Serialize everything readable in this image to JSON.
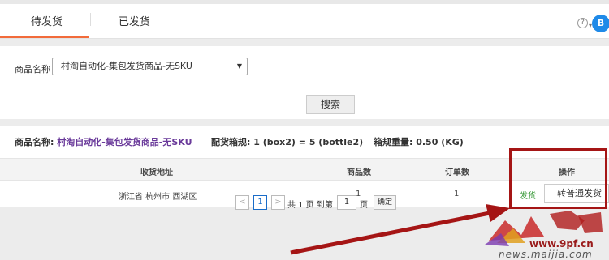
{
  "tabs": [
    {
      "label": "待发货",
      "active": true
    },
    {
      "label": "已发货",
      "active": false
    }
  ],
  "header": {
    "help_icon": "?",
    "avatar_initial": "B"
  },
  "filter": {
    "product_label": "商品名称",
    "product_selected": "村淘自动化-集包发货商品-无SKU",
    "search_button": "搜索"
  },
  "summary": {
    "product_prefix": "商品名称: ",
    "product_name": "村淘自动化-集包发货商品-无SKU",
    "package_spec": "配货箱规: 1 (box2) = 5 (bottle2)",
    "package_weight": "箱规重量: 0.50 (KG)"
  },
  "table": {
    "headers": [
      "收货地址",
      "商品数",
      "订单数",
      "操作"
    ],
    "rows": [
      {
        "address": "浙江省 杭州市 西湖区",
        "item_count": "1",
        "order_count": "1",
        "ship_action": "发货",
        "convert_action": "转普通发货"
      }
    ]
  },
  "pagination": {
    "prev": "<",
    "current": "1",
    "next": ">",
    "total_text": "共 1 页 到第",
    "goto_value": "1",
    "page_unit": "页",
    "confirm": "确定"
  },
  "watermark": {
    "site": "www.9pf.cn",
    "domain": "news.maijia.com"
  },
  "colors": {
    "accent_orange": "#f26b3a",
    "avatar_blue": "#1f8ae8",
    "highlight_red": "#a51515",
    "product_purple": "#6a3a9a",
    "ship_green": "#3a9a3a"
  }
}
